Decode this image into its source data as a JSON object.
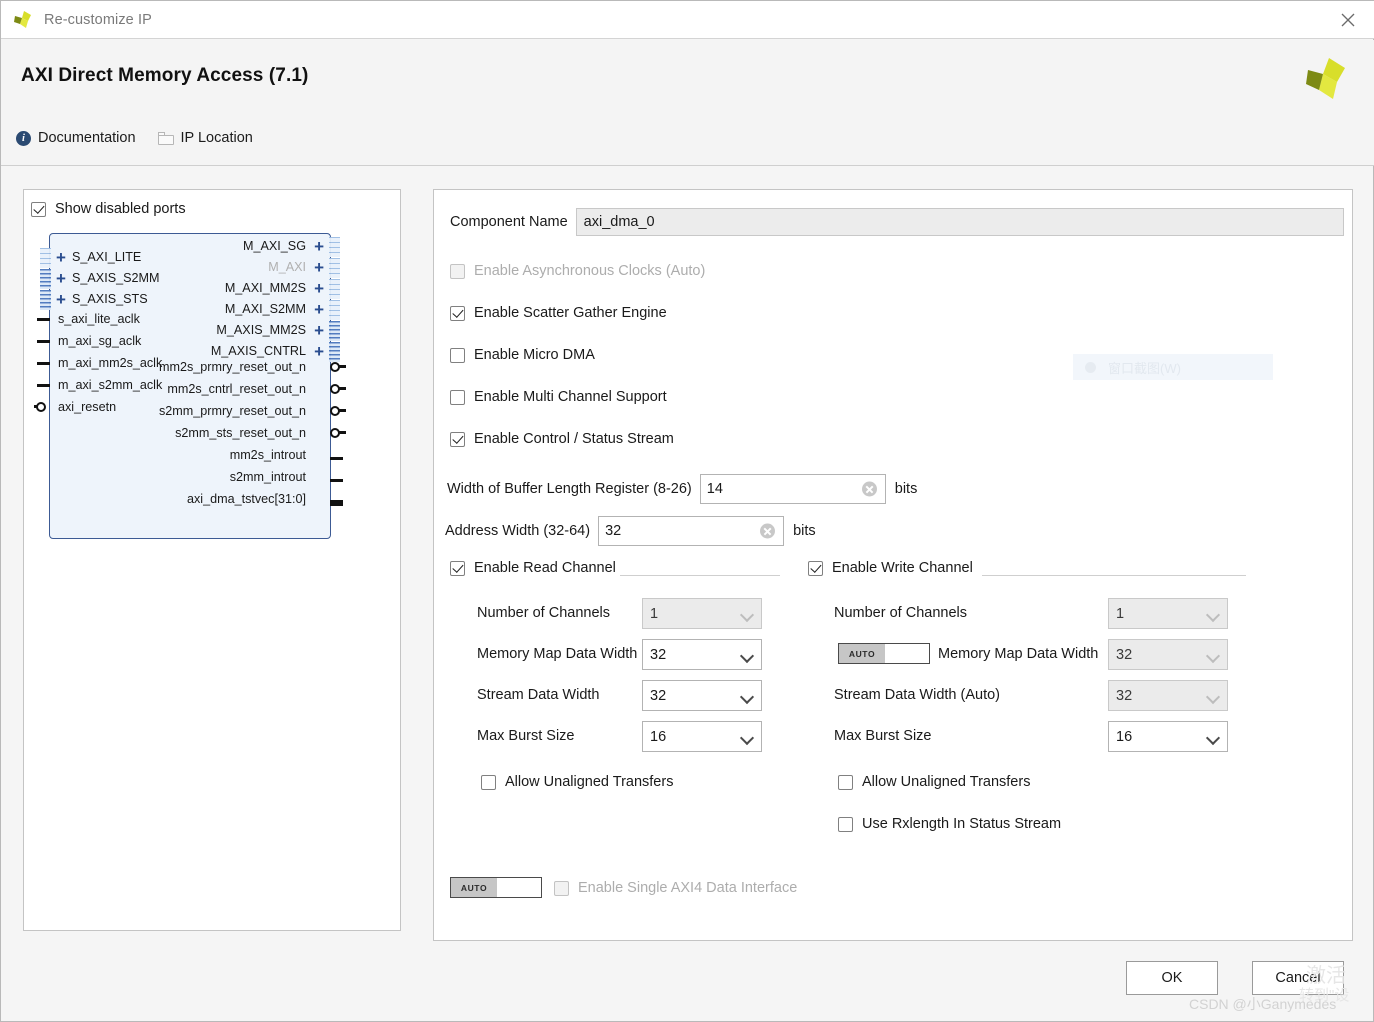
{
  "window": {
    "title": "Re-customize IP",
    "close_icon": "close-icon",
    "app_logo": "xilinx-logo"
  },
  "header": {
    "title": "AXI Direct Memory Access (7.1)",
    "links": [
      {
        "label": "Documentation",
        "icon": "info-icon"
      },
      {
        "label": "IP Location",
        "icon": "folder-icon"
      }
    ],
    "logo": "xilinx-logo"
  },
  "left_panel": {
    "show_disabled_ports": {
      "label": "Show disabled ports",
      "checked": true
    },
    "diagram": {
      "left_bus_ports": [
        {
          "name": "S_AXI_LITE",
          "expandable": true
        },
        {
          "name": "S_AXIS_S2MM",
          "expandable": true
        },
        {
          "name": "S_AXIS_STS",
          "expandable": true
        }
      ],
      "left_signal_ports": [
        {
          "name": "s_axi_lite_aclk",
          "type": "clock"
        },
        {
          "name": "m_axi_sg_aclk",
          "type": "clock"
        },
        {
          "name": "m_axi_mm2s_aclk",
          "type": "clock"
        },
        {
          "name": "m_axi_s2mm_aclk",
          "type": "clock"
        },
        {
          "name": "axi_resetn",
          "type": "reset"
        }
      ],
      "right_bus_ports": [
        {
          "name": "M_AXI_SG",
          "expandable": true,
          "disabled": false
        },
        {
          "name": "M_AXI",
          "expandable": true,
          "disabled": true
        },
        {
          "name": "M_AXI_MM2S",
          "expandable": true,
          "disabled": false
        },
        {
          "name": "M_AXI_S2MM",
          "expandable": true,
          "disabled": false
        },
        {
          "name": "M_AXIS_MM2S",
          "expandable": true,
          "disabled": false
        },
        {
          "name": "M_AXIS_CNTRL",
          "expandable": true,
          "disabled": false
        }
      ],
      "right_signal_ports": [
        {
          "name": "mm2s_prmry_reset_out_n",
          "type": "reset"
        },
        {
          "name": "mm2s_cntrl_reset_out_n",
          "type": "reset"
        },
        {
          "name": "s2mm_prmry_reset_out_n",
          "type": "reset"
        },
        {
          "name": "s2mm_sts_reset_out_n",
          "type": "reset"
        },
        {
          "name": "mm2s_introut",
          "type": "signal"
        },
        {
          "name": "s2mm_introut",
          "type": "signal"
        },
        {
          "name": "axi_dma_tstvec[31:0]",
          "type": "bus"
        }
      ]
    }
  },
  "main": {
    "component_name": {
      "label": "Component Name",
      "value": "axi_dma_0"
    },
    "options": [
      {
        "label": "Enable Asynchronous Clocks (Auto)",
        "checked": false,
        "disabled": true
      },
      {
        "label": "Enable Scatter Gather Engine",
        "checked": true,
        "disabled": false
      },
      {
        "label": "Enable Micro DMA",
        "checked": false,
        "disabled": false
      },
      {
        "label": "Enable Multi Channel Support",
        "checked": false,
        "disabled": false
      },
      {
        "label": "Enable Control / Status Stream",
        "checked": true,
        "disabled": false
      }
    ],
    "buffer_length": {
      "label": "Width of Buffer Length Register (8-26)",
      "value": "14",
      "unit": "bits"
    },
    "address_width": {
      "label": "Address Width (32-64)",
      "value": "32",
      "unit": "bits"
    },
    "read_channel": {
      "title": "Enable Read Channel",
      "checked": true,
      "fields": [
        {
          "label": "Number of Channels",
          "value": "1",
          "disabled": true
        },
        {
          "label": "Memory Map Data Width",
          "value": "32",
          "disabled": false
        },
        {
          "label": "Stream Data Width",
          "value": "32",
          "disabled": false
        },
        {
          "label": "Max Burst Size",
          "value": "16",
          "disabled": false
        }
      ],
      "checkboxes": [
        {
          "label": "Allow Unaligned Transfers",
          "checked": false
        }
      ]
    },
    "write_channel": {
      "title": "Enable Write Channel",
      "checked": true,
      "fields": [
        {
          "label": "Number of Channels",
          "value": "1",
          "disabled": true,
          "auto_toggle": false
        },
        {
          "label": "Memory Map Data Width",
          "value": "32",
          "disabled": true,
          "auto_toggle": true
        },
        {
          "label": "Stream Data Width (Auto)",
          "value": "32",
          "disabled": true,
          "auto_toggle": false
        },
        {
          "label": "Max Burst Size",
          "value": "16",
          "disabled": false,
          "auto_toggle": false
        }
      ],
      "checkboxes": [
        {
          "label": "Allow Unaligned Transfers",
          "checked": false
        },
        {
          "label": "Use Rxlength In Status Stream",
          "checked": false
        }
      ]
    },
    "single_axi4": {
      "label": "Enable Single AXI4 Data Interface",
      "checked": false,
      "disabled": true,
      "auto_toggle_label": "AUTO"
    },
    "auto_label": "AUTO"
  },
  "footer": {
    "ok_label": "OK",
    "cancel_label": "Cancel"
  },
  "overlays": {
    "ghost_tooltip": "窗口截图(W)",
    "watermark_csdn": "CSDN @小Ganymedes",
    "watermark_activate_line1": "激活",
    "watermark_activate_line2": "转到\"设"
  }
}
